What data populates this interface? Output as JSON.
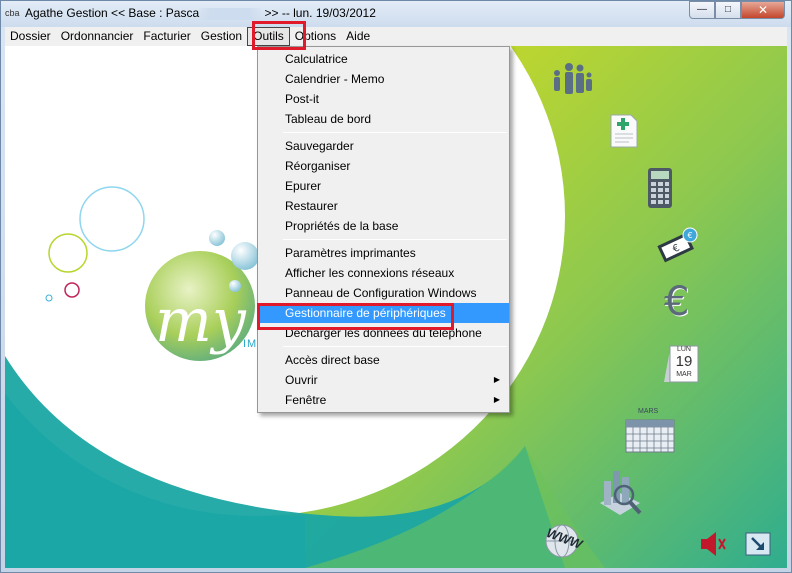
{
  "window": {
    "title_prefix": "Agathe Gestion << Base : Pasca",
    "title_suffix": ">>  --  lun. 19/03/2012",
    "app_icon_text": "cba",
    "buttons": {
      "minimize": "—",
      "maximize": "□",
      "close": "✕"
    }
  },
  "menubar": [
    {
      "label": "Dossier"
    },
    {
      "label": "Ordonnancier"
    },
    {
      "label": "Facturier"
    },
    {
      "label": "Gestion"
    },
    {
      "label": "Outils"
    },
    {
      "label": "Options"
    },
    {
      "label": "Aide"
    }
  ],
  "outils_menu": {
    "group1": [
      "Calculatrice",
      "Calendrier - Memo",
      "Post-it",
      "Tableau de bord"
    ],
    "group2": [
      "Sauvegarder",
      "Réorganiser",
      "Epurer",
      "Restaurer",
      "Propriétés de la base"
    ],
    "group3": [
      "Paramètres imprimantes",
      "Afficher les connexions réseaux",
      "Panneau de Configuration Windows",
      "Gestionnaire de périphériques",
      "Décharger les données du téléphone"
    ],
    "group4": [
      "Accès direct base",
      "Ouvrir",
      "Fenêtre"
    ],
    "selected": "Gestionnaire de périphériques",
    "submenu_arrow": "▶"
  },
  "logo": {
    "text": "my",
    "subtext": "IMA"
  },
  "calendar_icon": {
    "day_name": "LUN",
    "day_number": "19",
    "month": "MAR"
  },
  "month_grid_icon": {
    "month": "MARS"
  },
  "www_icon": {
    "text": "WWW"
  },
  "euro_icon": {
    "symbol": "€"
  },
  "colors": {
    "highlight_red": "#e0192b",
    "selection_blue": "#3399ff",
    "teal": "#19a6a6",
    "lime": "#d3d91f"
  }
}
